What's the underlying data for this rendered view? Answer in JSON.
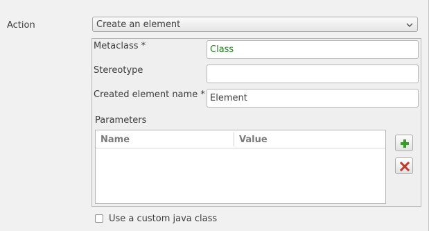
{
  "action": {
    "label": "Action",
    "selected": "Create an element"
  },
  "fields": {
    "metaclass": {
      "label": "Metaclass *",
      "value": "Class",
      "value_color": "#1a7f1a"
    },
    "stereotype": {
      "label": "Stereotype",
      "value": ""
    },
    "created_element_name": {
      "label": "Created element name *",
      "value": "Element"
    }
  },
  "parameters": {
    "label": "Parameters",
    "columns": [
      "Name",
      "Value"
    ],
    "rows": []
  },
  "buttons": {
    "add_icon": "plus-icon",
    "add_color": "#3a9b2a",
    "remove_icon": "x-icon",
    "remove_color": "#c0392b"
  },
  "custom_java_class": {
    "label": "Use a custom java class",
    "checked": false
  }
}
